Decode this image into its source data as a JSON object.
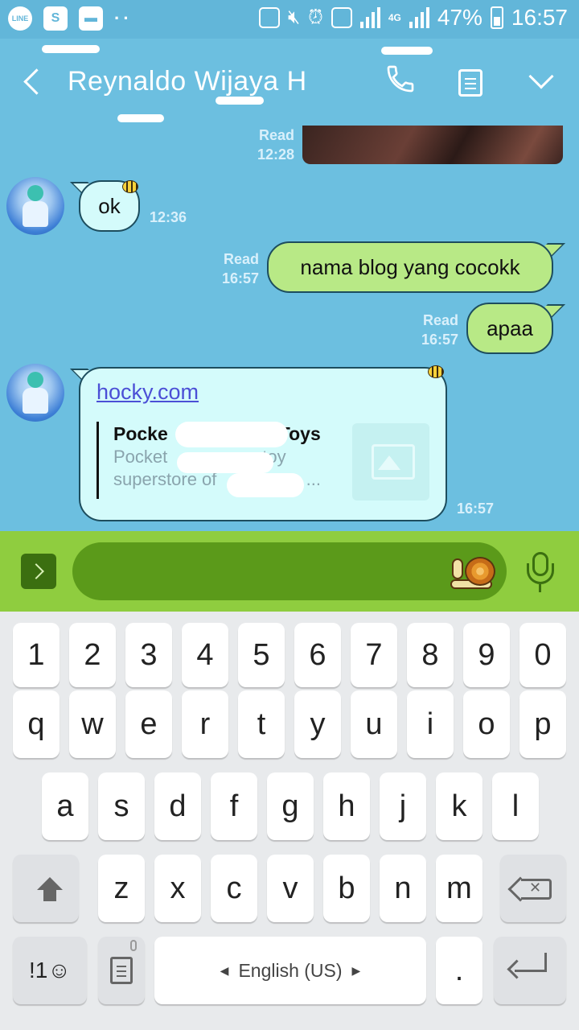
{
  "status_bar": {
    "left_icons": [
      "line-icon",
      "shop-icon",
      "message-icon"
    ],
    "battery": "47%",
    "time": "16:57",
    "network": "4G"
  },
  "header": {
    "contact_name": "Reynaldo Wijaya H"
  },
  "chat": {
    "media_meta": {
      "status": "Read",
      "time": "12:28"
    },
    "messages": [
      {
        "direction": "in",
        "text": "ok",
        "time": "12:36"
      },
      {
        "direction": "out",
        "text": "nama blog yang cocokk",
        "status": "Read",
        "time": "16:57"
      },
      {
        "direction": "out",
        "text": "apaa",
        "status": "Read",
        "time": "16:57"
      }
    ],
    "link_message": {
      "url": "hocky.com",
      "preview_title_start": "Pocke",
      "preview_title_end": "Toys",
      "preview_desc_line1_start": "Pocket",
      "preview_desc_line1_end": "toy",
      "preview_desc_line2_start": "superstore of",
      "preview_desc_line2_end": "s, ...",
      "time": "16:57"
    }
  },
  "input_bar": {
    "message_value": ""
  },
  "keyboard": {
    "row_numbers": [
      "1",
      "2",
      "3",
      "4",
      "5",
      "6",
      "7",
      "8",
      "9",
      "0"
    ],
    "row1": [
      "q",
      "w",
      "e",
      "r",
      "t",
      "y",
      "u",
      "i",
      "o",
      "p"
    ],
    "row2": [
      "a",
      "s",
      "d",
      "f",
      "g",
      "h",
      "j",
      "k",
      "l"
    ],
    "row3": [
      "z",
      "x",
      "c",
      "v",
      "b",
      "n",
      "m"
    ],
    "symbols_label": "!1☺",
    "space_label": "English (US)",
    "period_label": "."
  },
  "colors": {
    "chat_bg": "#6cbfe0",
    "incoming_bubble": "#d4fbfb",
    "outgoing_bubble": "#b8e986",
    "input_bar": "#8fcd3f",
    "input_field": "#5b9a1a"
  }
}
